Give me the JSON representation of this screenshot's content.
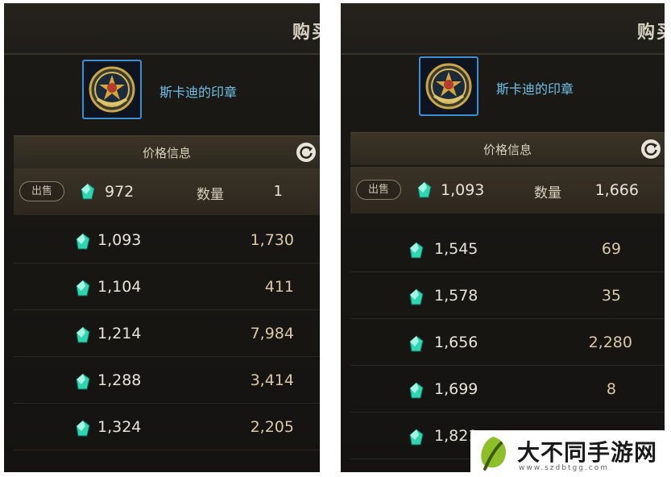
{
  "panels": [
    {
      "title": "购买",
      "item_name": "斯卡迪的印章",
      "price_header": "价格信息",
      "selected": {
        "sell_label": "出售",
        "price": "972",
        "qty_label": "数量",
        "qty": "1"
      },
      "rows": [
        {
          "price": "1,093",
          "qty": "1,730"
        },
        {
          "price": "1,104",
          "qty": "411"
        },
        {
          "price": "1,214",
          "qty": "7,984"
        },
        {
          "price": "1,288",
          "qty": "3,414"
        },
        {
          "price": "1,324",
          "qty": "2,205"
        }
      ]
    },
    {
      "title": "购买",
      "item_name": "斯卡迪的印章",
      "price_header": "价格信息",
      "selected": {
        "sell_label": "出售",
        "price": "1,093",
        "qty_label": "数量",
        "qty": "1,666"
      },
      "rows": [
        {
          "price": "1,545",
          "qty": "69"
        },
        {
          "price": "1,578",
          "qty": "35"
        },
        {
          "price": "1,656",
          "qty": "2,280"
        },
        {
          "price": "1,699",
          "qty": "8"
        },
        {
          "price": "1,821",
          "qty": ""
        }
      ]
    }
  ],
  "watermark": {
    "text": "大不同手游网",
    "url": "www.szdbtgg.com"
  },
  "colors": {
    "item_name": "#6fc0e6",
    "gem": "#2fd4b0",
    "frame": "#3d8fd0"
  }
}
